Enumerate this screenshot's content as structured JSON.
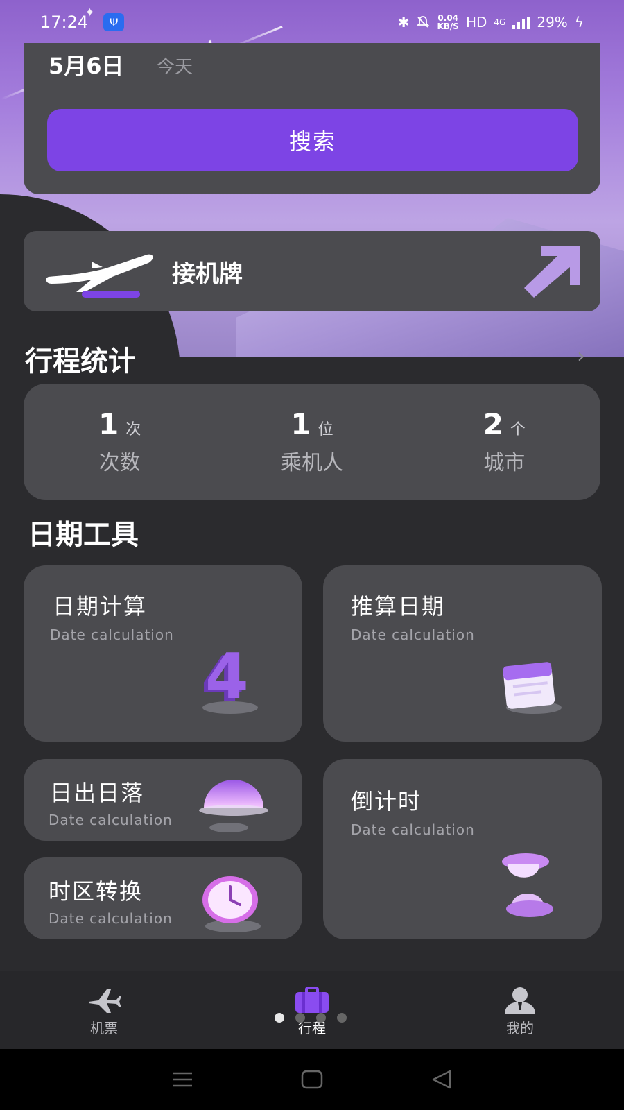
{
  "status_bar": {
    "time": "17:24",
    "net_speed_value": "0.04",
    "net_speed_unit": "KB/S",
    "hd": "HD",
    "network": "4G",
    "battery": "29%"
  },
  "search_card": {
    "date": "5月6日",
    "date_hint": "今天",
    "search_label": "搜索"
  },
  "pickup_card": {
    "label": "接机牌"
  },
  "trip_stats": {
    "title": "行程统计",
    "items": [
      {
        "value": "1",
        "unit": "次",
        "label": "次数"
      },
      {
        "value": "1",
        "unit": "位",
        "label": "乘机人"
      },
      {
        "value": "2",
        "unit": "个",
        "label": "城市"
      }
    ]
  },
  "date_tools": {
    "title": "日期工具",
    "date_calc": {
      "title": "日期计算",
      "subtitle": "Date calculation",
      "icon_text": "4"
    },
    "infer_date": {
      "title": "推算日期",
      "subtitle": "Date calculation"
    },
    "sunrise": {
      "title": "日出日落",
      "subtitle": "Date calculation"
    },
    "countdown": {
      "title": "倒计时",
      "subtitle": "Date calculation"
    },
    "timezone": {
      "title": "时区转换",
      "subtitle": "Date calculation"
    }
  },
  "tab_bar": {
    "tabs": [
      {
        "label": "机票",
        "icon": "airplane-icon"
      },
      {
        "label": "行程",
        "icon": "suitcase-icon"
      },
      {
        "label": "我的",
        "icon": "user-icon"
      }
    ],
    "active_index": 1
  },
  "colors": {
    "accent": "#7d44e5",
    "card": "#4b4b4f",
    "background": "#2b2b2e"
  }
}
